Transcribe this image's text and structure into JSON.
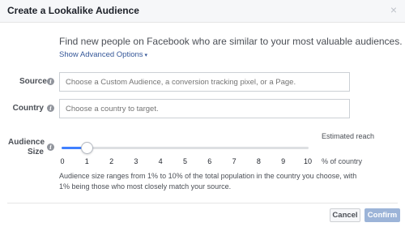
{
  "dialog": {
    "title": "Create a Lookalike Audience",
    "close_glyph": "×"
  },
  "intro": {
    "text": "Find new people on Facebook who are similar to your most valuable audiences.",
    "advanced_link": "Show Advanced Options",
    "advanced_caret": "▾"
  },
  "source": {
    "label": "Source",
    "placeholder": "Choose a Custom Audience, a conversion tracking pixel, or a Page."
  },
  "country": {
    "label": "Country",
    "placeholder": "Choose a country to target."
  },
  "audience_size": {
    "label_line1": "Audience",
    "label_line2": "Size",
    "estimated_reach_label": "Estimated reach",
    "ticks": [
      "0",
      "1",
      "2",
      "3",
      "4",
      "5",
      "6",
      "7",
      "8",
      "9",
      "10"
    ],
    "unit_label": "% of country",
    "selected_value": 1,
    "max_value": 10,
    "note": "Audience size ranges from 1% to 10% of the total population in the country you choose, with 1% being those who most closely match your source."
  },
  "info_icon_glyph": "i",
  "footer": {
    "cancel_label": "Cancel",
    "confirm_label": "Confirm"
  },
  "colors": {
    "link": "#365899",
    "slider_fill": "#4080ff",
    "confirm_disabled": "#9cb4d8"
  }
}
